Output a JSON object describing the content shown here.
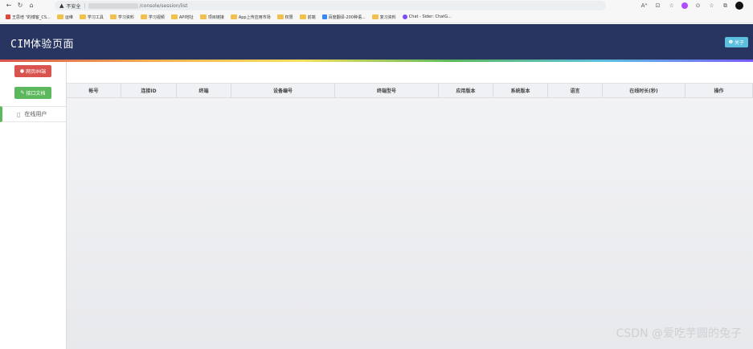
{
  "browser": {
    "nav": [
      "←",
      "↻",
      "⌂"
    ],
    "insecure_label": "不安全",
    "url_path": "/console/session/list",
    "right_icons": [
      "Aᴬ",
      "⊡",
      "☆",
      "⊙",
      "☆",
      "⧉",
      "⋯"
    ],
    "bookmarks": [
      {
        "label": "王思培 \"的博客_CS...",
        "icon": "red"
      },
      {
        "label": "运维",
        "icon": "folder"
      },
      {
        "label": "学习工具",
        "icon": "folder"
      },
      {
        "label": "学习资料",
        "icon": "folder"
      },
      {
        "label": "学习视频",
        "icon": "folder"
      },
      {
        "label": "API地址",
        "icon": "folder"
      },
      {
        "label": "项目链接",
        "icon": "folder"
      },
      {
        "label": "App上传应用市场",
        "icon": "folder"
      },
      {
        "label": "权限",
        "icon": "folder"
      },
      {
        "label": "前端",
        "icon": "folder"
      },
      {
        "label": "百度翻译-200种语...",
        "icon": "blue"
      },
      {
        "label": "复习资料",
        "icon": "folder"
      },
      {
        "label": "Chat - Sider: ChatG...",
        "icon": "purple"
      }
    ]
  },
  "header": {
    "title": "CIM体验页面",
    "about_label": "关于",
    "about_icon": "info-circle-icon",
    "bg_color": "#283561"
  },
  "sidebar": {
    "web_im_label": "网页IM端",
    "api_docs_label": "接口文档",
    "online_users_label": "在线用户"
  },
  "table": {
    "columns": [
      "帐号",
      "连接ID",
      "终端",
      "设备编号",
      "终端型号",
      "应用版本",
      "系统版本",
      "语言",
      "在线时长(秒)",
      "操作"
    ]
  },
  "watermark": "CSDN @爱吃芋圆的兔子"
}
